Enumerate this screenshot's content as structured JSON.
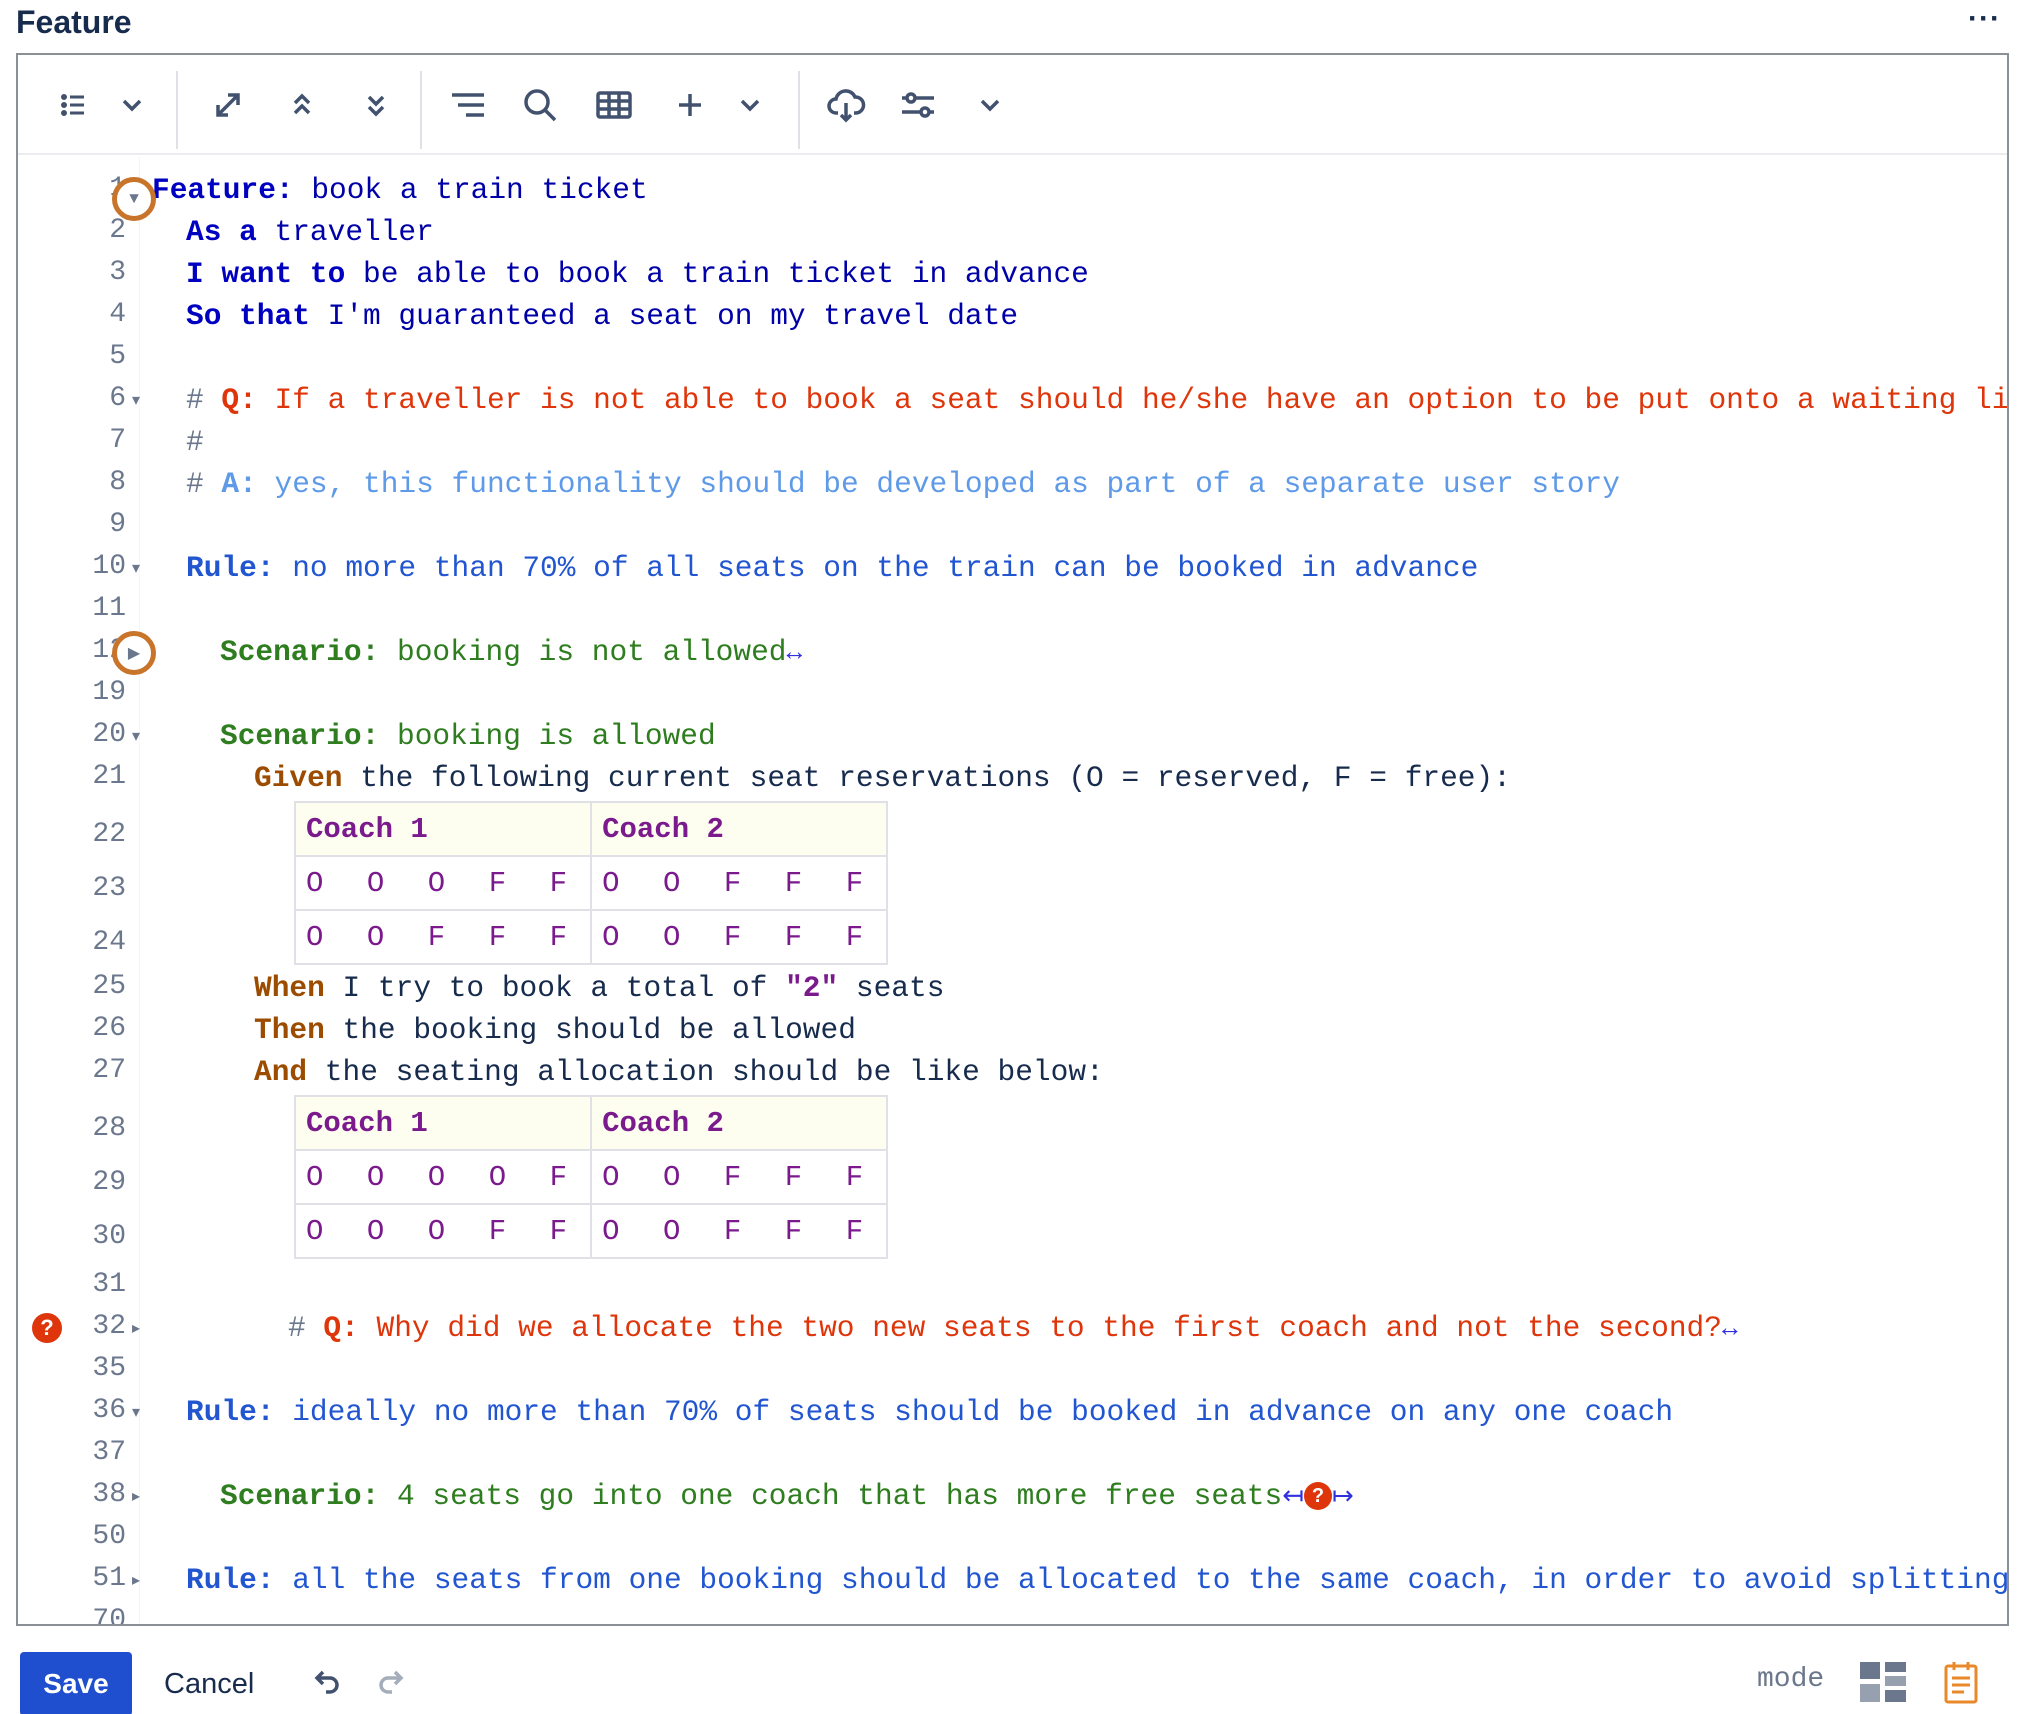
{
  "panel": {
    "title": "Feature",
    "more": "···"
  },
  "toolbar": {
    "icons": [
      "list-icon",
      "chevron-down-icon",
      "expand-icon",
      "collapse-up-icon",
      "collapse-down-icon",
      "outline-icon",
      "search-icon",
      "table-icon",
      "plus-icon",
      "chevron-down-icon",
      "cloud-download-icon",
      "settings-sliders-icon",
      "chevron-down-icon"
    ]
  },
  "lines": {
    "l1": {
      "n": "1",
      "kw": "Feature:",
      "text": " book a train ticket"
    },
    "l2": {
      "n": "2",
      "kw": "As a",
      "text": " traveller"
    },
    "l3": {
      "n": "3",
      "kw": "I want to",
      "text": " be able to book a train ticket in advance"
    },
    "l4": {
      "n": "4",
      "kw": "So that",
      "text": " I'm guaranteed a seat on my travel date"
    },
    "l5": {
      "n": "5"
    },
    "l6": {
      "n": "6",
      "hash": "# ",
      "kw": "Q:",
      "text": " If a traveller is not able to book a seat should he/she have an option to be put onto a waiting list?"
    },
    "l7": {
      "n": "7",
      "hash": "#"
    },
    "l8": {
      "n": "8",
      "hash": "# ",
      "kw": "A:",
      "text": " yes, this functionality should be developed as part of a separate user story"
    },
    "l9": {
      "n": "9"
    },
    "l10": {
      "n": "10",
      "kw": "Rule:",
      "text": " no more than 70% of all seats on the train can be booked in advance"
    },
    "l11": {
      "n": "11"
    },
    "l12": {
      "n": "12",
      "kw": "Scenario:",
      "text": " booking is not allowed",
      "expand": "↔"
    },
    "l19": {
      "n": "19"
    },
    "l20": {
      "n": "20",
      "kw": "Scenario:",
      "text": " booking is allowed"
    },
    "l21": {
      "n": "21",
      "kw": "Given",
      "text": " the following current seat reservations (O = reserved, F = free):"
    },
    "l22": {
      "n": "22"
    },
    "l23": {
      "n": "23"
    },
    "l24": {
      "n": "24"
    },
    "l25": {
      "n": "25",
      "kw": "When",
      "text_a": " I try to book a total of ",
      "str": "\"2\"",
      "text_b": " seats"
    },
    "l26": {
      "n": "26",
      "kw": "Then",
      "text": " the booking should be allowed"
    },
    "l27": {
      "n": "27",
      "kw": "And",
      "text": " the seating allocation should be like below:"
    },
    "l28": {
      "n": "28"
    },
    "l29": {
      "n": "29"
    },
    "l30": {
      "n": "30"
    },
    "l31": {
      "n": "31"
    },
    "l32": {
      "n": "32",
      "hash": "# ",
      "kw": "Q:",
      "text": " Why did we allocate the two new seats to the first coach and not the second?",
      "expand": "↔"
    },
    "l35": {
      "n": "35"
    },
    "l36": {
      "n": "36",
      "kw": "Rule:",
      "text": " ideally no more than 70% of seats should be booked in advance on any one coach"
    },
    "l37": {
      "n": "37"
    },
    "l38": {
      "n": "38",
      "kw": "Scenario:",
      "text": " 4 seats go into one coach that has more free seats",
      "expand_l": "↤",
      "err": "?",
      "expand_r": "↦"
    },
    "l50": {
      "n": "50"
    },
    "l51": {
      "n": "51",
      "kw": "Rule:",
      "text": " all the seats from one booking should be allocated to the same coach, in order to avoid splitting groups"
    },
    "l70": {
      "n": "70"
    }
  },
  "table1": {
    "headers": [
      "Coach 1",
      "Coach 2"
    ],
    "rows": [
      [
        "O O O F F",
        "O O F F F"
      ],
      [
        "O O F F F",
        "O O F F F"
      ]
    ]
  },
  "table2": {
    "headers": [
      "Coach 1",
      "Coach 2"
    ],
    "rows": [
      [
        "O O O O F",
        "O O F F F"
      ],
      [
        "O O O F F",
        "O O F F F"
      ]
    ]
  },
  "markers": {
    "err_gutter": "?"
  },
  "bottom": {
    "save": "Save",
    "cancel": "Cancel",
    "mode": "mode"
  },
  "colors": {
    "accent": "#1f4fcf",
    "feature_kw": "#0000c0",
    "question": "#de350b",
    "answer": "#5e9ae8",
    "rule": "#2256d1",
    "scenario": "#2e7d1f",
    "step": "#9c4c00",
    "string": "#7a1a8c",
    "fold_highlight": "#c8742a"
  }
}
